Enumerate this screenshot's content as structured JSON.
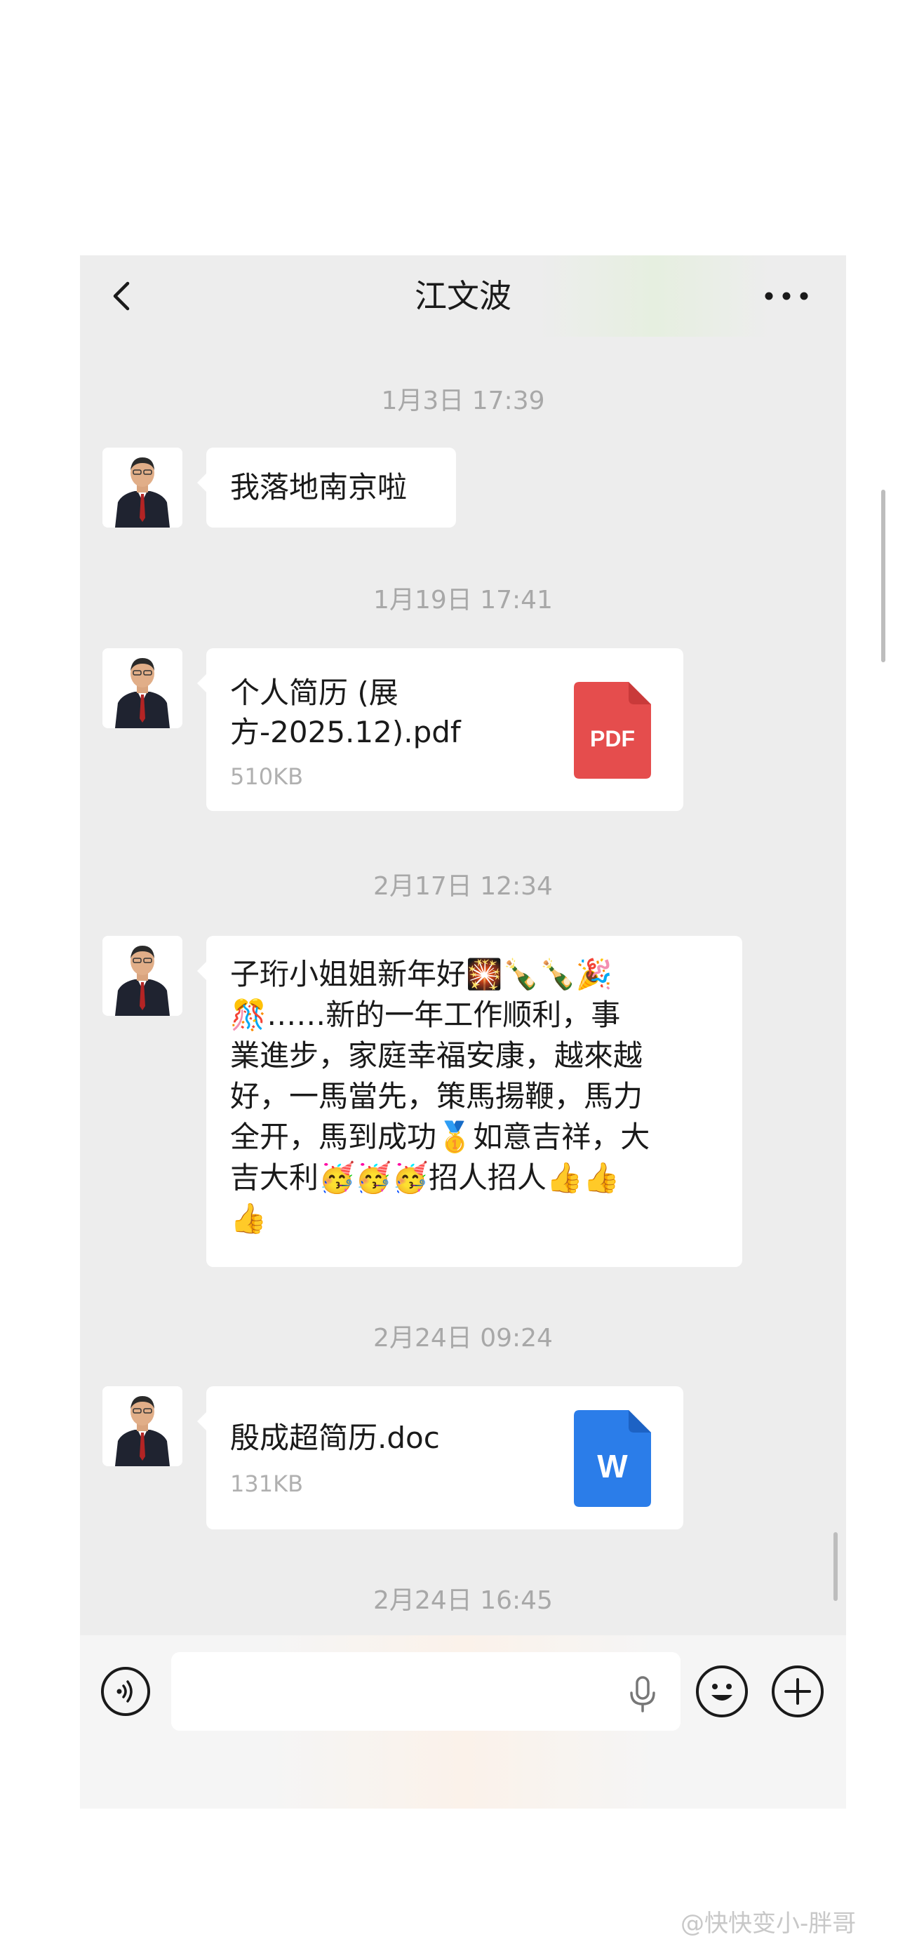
{
  "chat": {
    "title": "江文波",
    "back_icon": "chevron-left-icon",
    "more_icon": "ellipsis-icon"
  },
  "messages": [
    {
      "timestamp": "1月3日 17:39",
      "type": "text",
      "text": "我落地南京啦"
    },
    {
      "timestamp": "1月19日 17:41",
      "type": "file",
      "file_name": "个人简历 (展方-2025.12).pdf",
      "file_name_line1": "个人简历 (展",
      "file_name_line2": "方-2025.12).pdf",
      "file_size": "510KB",
      "file_icon_label": "PDF",
      "file_icon_color": "#e54d4d"
    },
    {
      "timestamp": "2月17日 12:34",
      "type": "text",
      "lines": [
        "子珩小姐姐新年好🎇🍾🍾🎉",
        "🎊……新的一年工作顺利，事",
        "業進步，家庭幸福安康，越來越",
        "好，一馬當先，策馬揚鞭，馬力",
        "全开，馬到成功🥇如意吉祥，大",
        "吉大利🥳🥳🥳招人招人👍👍",
        "👍"
      ]
    },
    {
      "timestamp": "2月24日 09:24",
      "type": "file",
      "file_name": "殷成超简历.doc",
      "file_size": "131KB",
      "file_icon_label": "W",
      "file_icon_color": "#2b7de9"
    },
    {
      "timestamp": "2月24日 16:45"
    }
  ],
  "input_bar": {
    "voice_icon": "voice-mode-icon",
    "mic_icon": "microphone-icon",
    "emoji_icon": "emoji-icon",
    "plus_icon": "plus-icon"
  },
  "watermark": "@快快变小-胖哥"
}
